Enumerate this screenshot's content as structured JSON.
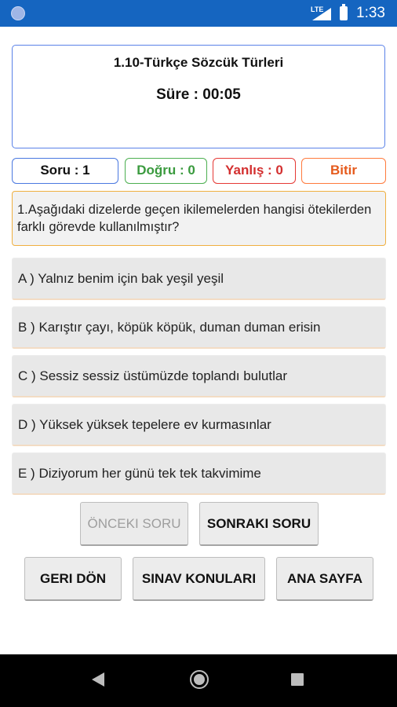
{
  "status_bar": {
    "network": "LTE",
    "time": "1:33"
  },
  "quiz": {
    "title": "1.10-Türkçe Sözcük Türleri",
    "timer": "Süre : 00:05"
  },
  "counters": {
    "question": "Soru : 1",
    "correct": "Doğru : 0",
    "wrong": "Yanlış : 0",
    "finish": "Bitir"
  },
  "question": {
    "text": "1.Aşağıdaki dizelerde geçen ikilemelerden hangisi ötekilerden farklı görevde kullanılmıştır?"
  },
  "options": [
    "A ) Yalnız benim için bak yeşil yeşil",
    "B ) Karıştır çayı, köpük köpük, duman duman erisin",
    "C ) Sessiz sessiz üstümüzde toplandı bulutlar",
    "D ) Yüksek yüksek tepelere ev kurmasınlar",
    "E ) Diziyorum her günü tek tek takvimime"
  ],
  "nav_buttons": {
    "previous": "ÖNCEKI SORU",
    "next": "SONRAKI SORU"
  },
  "bottom_buttons": {
    "back": "GERI DÖN",
    "topics": "SINAV KONULARI",
    "home": "ANA SAYFA"
  },
  "colors": {
    "status_bar": "#1565c0",
    "header_border": "#5a82e8",
    "correct": "#3a9a3e",
    "wrong": "#d32f2f",
    "finish": "#e55a1c",
    "question_border": "#f0b040"
  }
}
